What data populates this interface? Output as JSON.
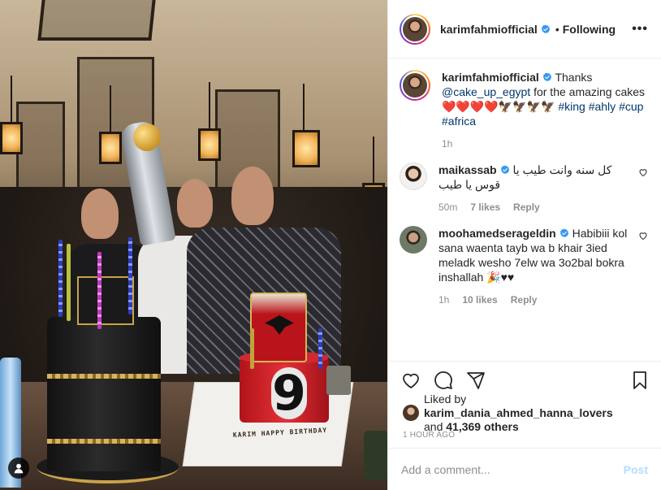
{
  "post": {
    "author": "karimfahmiofficial",
    "follow_status": "Following",
    "more_glyph": "•••",
    "dot": "•"
  },
  "photo": {
    "cake_plate_text": "KARIM HAPPY BIRTHDAY",
    "cake_number": "9"
  },
  "caption": {
    "user": "karimfahmiofficial",
    "text_before": "Thanks ",
    "mention": "@cake_up_egypt",
    "text_after": " for the amazing cakes ",
    "emojis": "❤️❤️❤️❤️🦅🦅🦅🦅",
    "hashtags": [
      "#king",
      "#ahly",
      "#cup",
      "#africa"
    ],
    "time": "1h"
  },
  "comments": [
    {
      "user": "maikassab",
      "text": "كل سنه وانت طيب يا قوس يا طيب",
      "time": "50m",
      "likes": "7 likes",
      "reply": "Reply"
    },
    {
      "user": "moohamedserageldin",
      "text": "Habibiii kol sana waenta tayb wa b khair 3ied meladk wesho 7elw wa 3o2bal bokra inshallah 🎉♥♥",
      "time": "1h",
      "likes": "10 likes",
      "reply": "Reply"
    }
  ],
  "likes": {
    "prefix": "Liked by ",
    "user": "karim_dania_ahmed_hanna_lovers",
    "and": "and ",
    "count": "41,369 others"
  },
  "time_ago": "1 HOUR AGO",
  "add_comment": {
    "placeholder": "Add a comment...",
    "post_label": "Post"
  },
  "icons": {
    "heart": "heart-icon",
    "comment": "comment-icon",
    "share": "paper-plane-icon",
    "save": "bookmark-icon",
    "verified": "verified-badge-icon",
    "user_tag": "user-tag-icon"
  },
  "colors": {
    "link": "#00376b",
    "verified": "#3897f0",
    "muted": "#8e8e8e",
    "post_disabled": "#b2dffc"
  }
}
